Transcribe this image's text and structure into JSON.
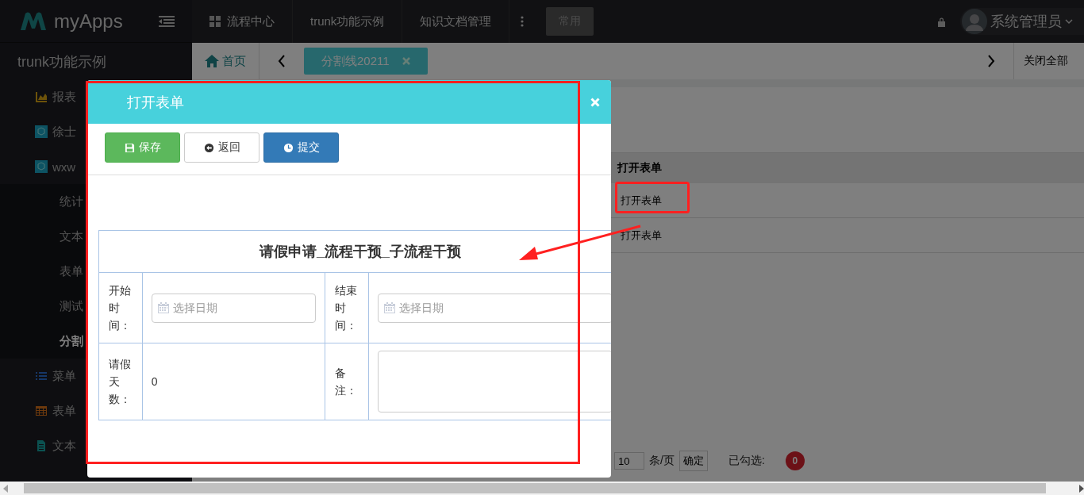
{
  "topbar": {
    "logo": "myApps",
    "nav": [
      {
        "label": "流程中心",
        "kind": "grid"
      },
      {
        "label": "trunk功能示例",
        "kind": "plain"
      },
      {
        "label": "知识文档管理",
        "kind": "plain"
      }
    ],
    "common_button": "常用",
    "user": "系统管理员"
  },
  "sidebar": {
    "title": "trunk功能示例",
    "items": [
      {
        "label": "报表",
        "kind": "chart"
      },
      {
        "label": "徐士",
        "kind": "cube"
      },
      {
        "label": "wxw",
        "kind": "cube",
        "children": [
          {
            "label": "统计",
            "selected": false
          },
          {
            "label": "文本",
            "selected": false
          },
          {
            "label": "表单",
            "selected": false
          },
          {
            "label": "测试",
            "selected": false
          },
          {
            "label": "分割",
            "selected": true
          }
        ]
      },
      {
        "label": "菜单",
        "kind": "list"
      },
      {
        "label": "表单",
        "kind": "table"
      },
      {
        "label": "文本",
        "kind": "doc"
      }
    ]
  },
  "tabbar": {
    "home": "首页",
    "tabs": [
      {
        "label": "分割线20211",
        "selected": true
      }
    ],
    "close_all": "关闭全部"
  },
  "table": {
    "header": "打开表单",
    "rows": [
      "打开表单",
      "打开表单"
    ]
  },
  "pager": {
    "page_size": "10",
    "unit": "条/页",
    "confirm": "确定",
    "checked_label": "已勾选:",
    "checked_count": "0"
  },
  "dialog": {
    "title": "打开表单",
    "buttons": [
      {
        "label": "保存",
        "kind": "save"
      },
      {
        "label": "返回",
        "kind": "back"
      },
      {
        "label": "提交",
        "kind": "submit"
      }
    ],
    "form": {
      "title": "请假申请_流程干预_子流程干预",
      "rows": [
        [
          {
            "label": "开始时间：",
            "kind": "date",
            "placeholder": "选择日期"
          },
          {
            "label": "结束时间：",
            "kind": "date",
            "placeholder": "选择日期"
          }
        ],
        [
          {
            "label": "请假天数：",
            "kind": "text",
            "value": "0"
          },
          {
            "label": "备注：",
            "kind": "textarea"
          }
        ]
      ]
    }
  }
}
